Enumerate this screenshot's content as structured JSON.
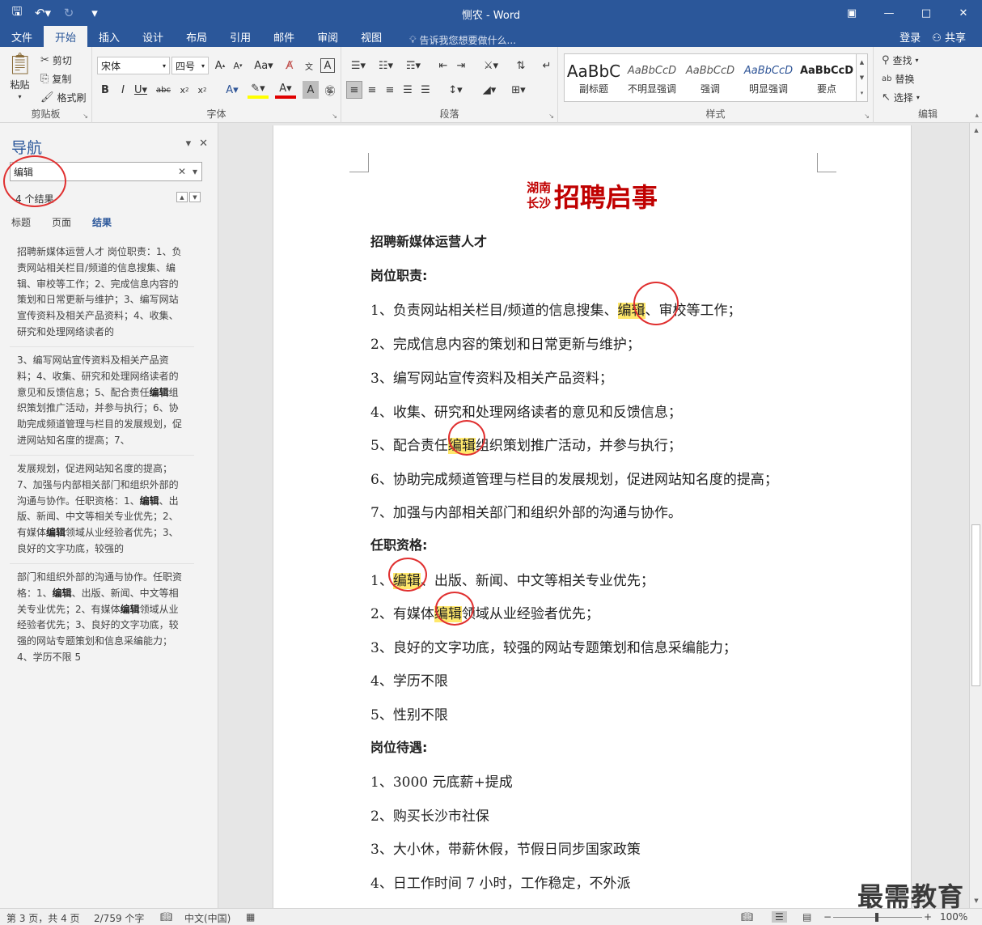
{
  "window": {
    "title": "恻农 - Word",
    "qat_icons": [
      "save-icon",
      "undo-icon",
      "redo-icon",
      "customize-icon"
    ]
  },
  "ribbon_tabs": [
    "文件",
    "开始",
    "插入",
    "设计",
    "布局",
    "引用",
    "邮件",
    "审阅",
    "视图"
  ],
  "active_tab": "开始",
  "tell_me": "告诉我您想要做什么...",
  "signin": "登录",
  "share": "共享",
  "clipboard": {
    "paste": "粘贴",
    "cut": "剪切",
    "copy": "复制",
    "format_painter": "格式刷",
    "label": "剪贴板"
  },
  "font": {
    "name": "宋体",
    "size": "四号",
    "label": "字体"
  },
  "paragraph": {
    "label": "段落"
  },
  "styles": {
    "label": "样式",
    "items": [
      {
        "sample": "AaBbC",
        "name": "副标题"
      },
      {
        "sample": "AaBbCcD",
        "name": "不明显强调"
      },
      {
        "sample": "AaBbCcD",
        "name": "强调"
      },
      {
        "sample": "AaBbCcD",
        "name": "明显强调"
      },
      {
        "sample": "AaBbCcD",
        "name": "要点"
      }
    ]
  },
  "editing": {
    "find": "查找",
    "replace": "替换",
    "select": "选择",
    "label": "编辑"
  },
  "nav": {
    "title": "导航",
    "search_value": "编辑",
    "result_count": "4 个结果",
    "tabs": [
      "标题",
      "页面",
      "结果"
    ],
    "active_tab": "结果",
    "results": [
      [
        "招聘新媒体运营人才 岗位职责：1、负",
        "责网站相关栏目/频道的信息搜集、编",
        "辑、审校等工作；2、完成信息内容的",
        "策划和日常更新与维护；3、编写网站",
        "宣传资料及相关产品资料；4、收集、",
        "研究和处理网络读者的"
      ],
      [
        "3、编写网站宣传资料及相关产品资",
        "料；4、收集、研究和处理网络读者的",
        "意见和反馈信息；5、配合责任编辑组",
        "织策划推广活动，并参与执行；6、协",
        "助完成频道管理与栏目的发展规划，促",
        "进网站知名度的提高；7、"
      ],
      [
        "发展规划，促进网站知名度的提高；",
        "7、加强与内部相关部门和组织外部的",
        "沟通与协作。任职资格：1、编辑、出",
        "版、新闻、中文等相关专业优先；2、",
        "有媒体编辑领域从业经验者优先；3、",
        "良好的文字功底，较强的"
      ],
      [
        "部门和组织外部的沟通与协作。任职资",
        "格：1、编辑、出版、新闻、中文等相",
        "关专业优先；2、有媒体编辑领域从业",
        "经验者优先；3、良好的文字功底，较",
        "强的网站专题策划和信息采编能力；",
        "4、学历不限 5"
      ]
    ]
  },
  "document": {
    "title_small_1": "湖南",
    "title_small_2": "长沙",
    "title_big": "招聘启事",
    "lines": [
      {
        "text": "招聘新媒体运营人才",
        "head": true
      },
      {
        "text": "岗位职责:",
        "head": true
      },
      {
        "pre": "1、负责网站相关栏目/频道的信息搜集、",
        "hl": "编辑",
        "post": "、审校等工作；"
      },
      {
        "text": "2、完成信息内容的策划和日常更新与维护；"
      },
      {
        "text": "3、编写网站宣传资料及相关产品资料；"
      },
      {
        "text": "4、收集、研究和处理网络读者的意见和反馈信息；"
      },
      {
        "pre": "5、配合责任",
        "hl": "编辑",
        "post": "组织策划推广活动，并参与执行；"
      },
      {
        "text": "6、协助完成频道管理与栏目的发展规划，促进网站知名度的提高；"
      },
      {
        "text": "7、加强与内部相关部门和组织外部的沟通与协作。"
      },
      {
        "text": "任职资格:",
        "head": true
      },
      {
        "pre": "1、",
        "hl": "编辑",
        "post": "、出版、新闻、中文等相关专业优先；"
      },
      {
        "pre": "2、有媒体",
        "hl": "编辑",
        "post": "领域从业经验者优先；"
      },
      {
        "text": "3、良好的文字功底，较强的网站专题策划和信息采编能力；"
      },
      {
        "text": "4、学历不限"
      },
      {
        "text": "5、性别不限"
      },
      {
        "text": "岗位待遇:",
        "head": true
      },
      {
        "text": "1、3000 元底薪+提成"
      },
      {
        "text": "2、购买长沙市社保"
      },
      {
        "text": "3、大小休，带薪休假，节假日同步国家政策"
      },
      {
        "text": "4、日工作时间 7 小时，工作稳定，不外派"
      }
    ]
  },
  "status": {
    "page": "第 3 页，共 4 页",
    "words": "2/759 个字",
    "language": "中文(中国)",
    "zoom": "100%"
  },
  "watermark": "最需教育"
}
